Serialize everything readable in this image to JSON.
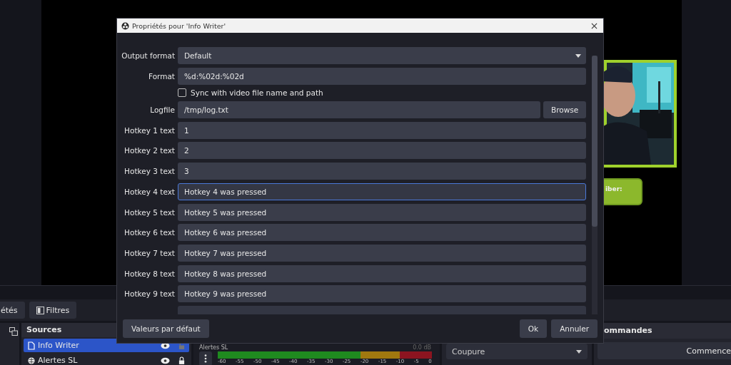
{
  "preview": {
    "badge": "iber:"
  },
  "toolbar": {
    "buttons": [
      {
        "kind": "plain",
        "label": "étés"
      },
      {
        "kind": "filter",
        "label": "Filtres"
      }
    ]
  },
  "sources": {
    "title": "Sources",
    "items": [
      {
        "name": "Info Writer",
        "kind": "text",
        "selected": true,
        "visible": true,
        "locked": false
      },
      {
        "name": "Alertes SL",
        "kind": "browser",
        "selected": false,
        "visible": true,
        "locked": true
      }
    ]
  },
  "mixer": {
    "channel": "Alertes SL",
    "reading": "0.0 dB",
    "ticks": [
      "-60",
      "-55",
      "-50",
      "-45",
      "-40",
      "-35",
      "-30",
      "-25",
      "-20",
      "-15",
      "-10",
      "-5",
      "0"
    ]
  },
  "transitions": {
    "value": "Coupure"
  },
  "commands": {
    "title": "ommandes",
    "button": "Commence"
  },
  "dialog": {
    "title": "Propriétés pour 'Info Writer'",
    "properties": [
      {
        "kind": "dropdown",
        "label": "Output format",
        "value": "Default"
      },
      {
        "kind": "text",
        "label": "Format",
        "value": "%d:%02d:%02d",
        "focused": false
      },
      {
        "kind": "checkbox",
        "label": "Sync with video file name and path",
        "checked": false
      },
      {
        "kind": "file",
        "label": "Logfile",
        "value": "/tmp/log.txt",
        "button": "Browse"
      },
      {
        "kind": "text",
        "label": "Hotkey 1 text",
        "value": "1",
        "focused": false
      },
      {
        "kind": "text",
        "label": "Hotkey 2 text",
        "value": "2",
        "focused": false
      },
      {
        "kind": "text",
        "label": "Hotkey 3 text",
        "value": "3",
        "focused": false
      },
      {
        "kind": "text",
        "label": "Hotkey 4 text",
        "value": "Hotkey 4 was pressed",
        "focused": true
      },
      {
        "kind": "text",
        "label": "Hotkey 5 text",
        "value": "Hotkey 5 was pressed",
        "focused": false
      },
      {
        "kind": "text",
        "label": "Hotkey 6 text",
        "value": "Hotkey 6 was pressed",
        "focused": false
      },
      {
        "kind": "text",
        "label": "Hotkey 7 text",
        "value": "Hotkey 7 was pressed",
        "focused": false
      },
      {
        "kind": "text",
        "label": "Hotkey 8 text",
        "value": "Hotkey 8 was pressed",
        "focused": false
      },
      {
        "kind": "text",
        "label": "Hotkey 9 text",
        "value": "Hotkey 9 was pressed",
        "focused": false
      }
    ],
    "defaults_button": "Valeurs par défaut",
    "ok_button": "Ok",
    "cancel_button": "Annuler"
  }
}
